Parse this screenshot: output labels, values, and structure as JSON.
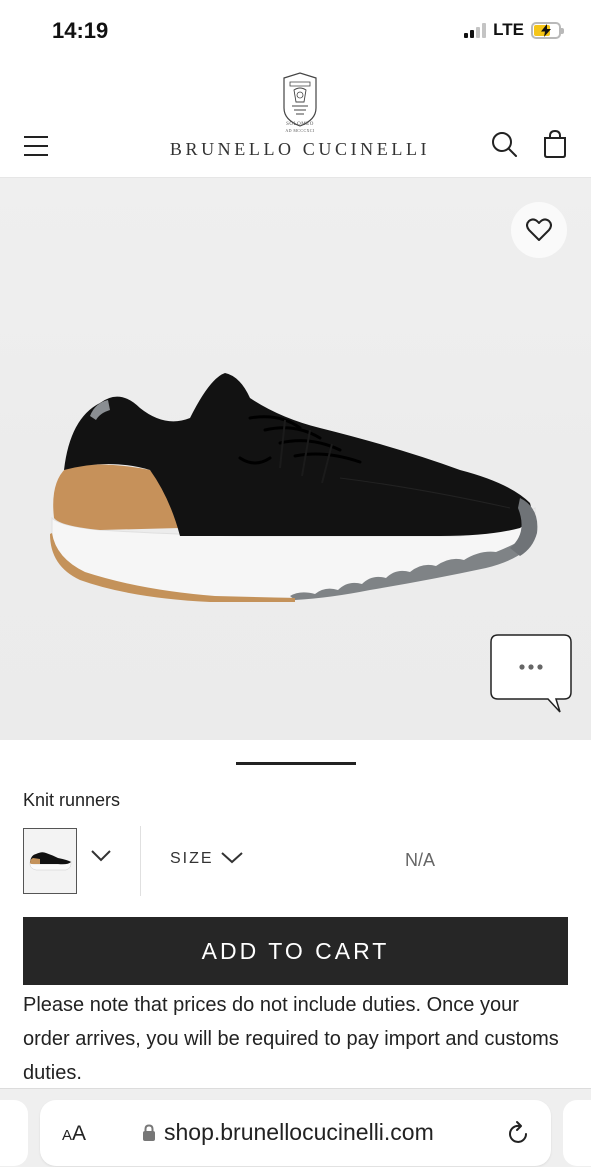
{
  "status_bar": {
    "time": "14:19",
    "network": "LTE"
  },
  "header": {
    "brand_name": "BRUNELLO CUCINELLI",
    "logo_caption_top": "SOLOMEO",
    "logo_caption_bottom": "AD MCCCXCI",
    "menu_icon": "hamburger-menu-icon",
    "search_icon": "search-icon",
    "bag_icon": "shopping-bag-icon"
  },
  "product": {
    "name": "Knit runners",
    "favorite_icon": "heart-icon",
    "chat_icon": "chat-bubble-icon",
    "color_selector_icon": "chevron-down-icon",
    "size_label": "SIZE",
    "size_value": "N/A",
    "add_to_cart_label": "ADD TO CART",
    "duties_note": "Please note that prices do not include duties. Once your order arrives, you will be required to pay import and customs duties."
  },
  "browser": {
    "text_size_label_big": "A",
    "text_size_label_small": "A",
    "url": "shop.brunellocucinelli.com",
    "reload_icon": "reload-icon",
    "lock_icon": "lock-icon"
  },
  "colors": {
    "button_background": "#262626",
    "image_background": "#ececec",
    "battery_charging": "#f5c518"
  }
}
